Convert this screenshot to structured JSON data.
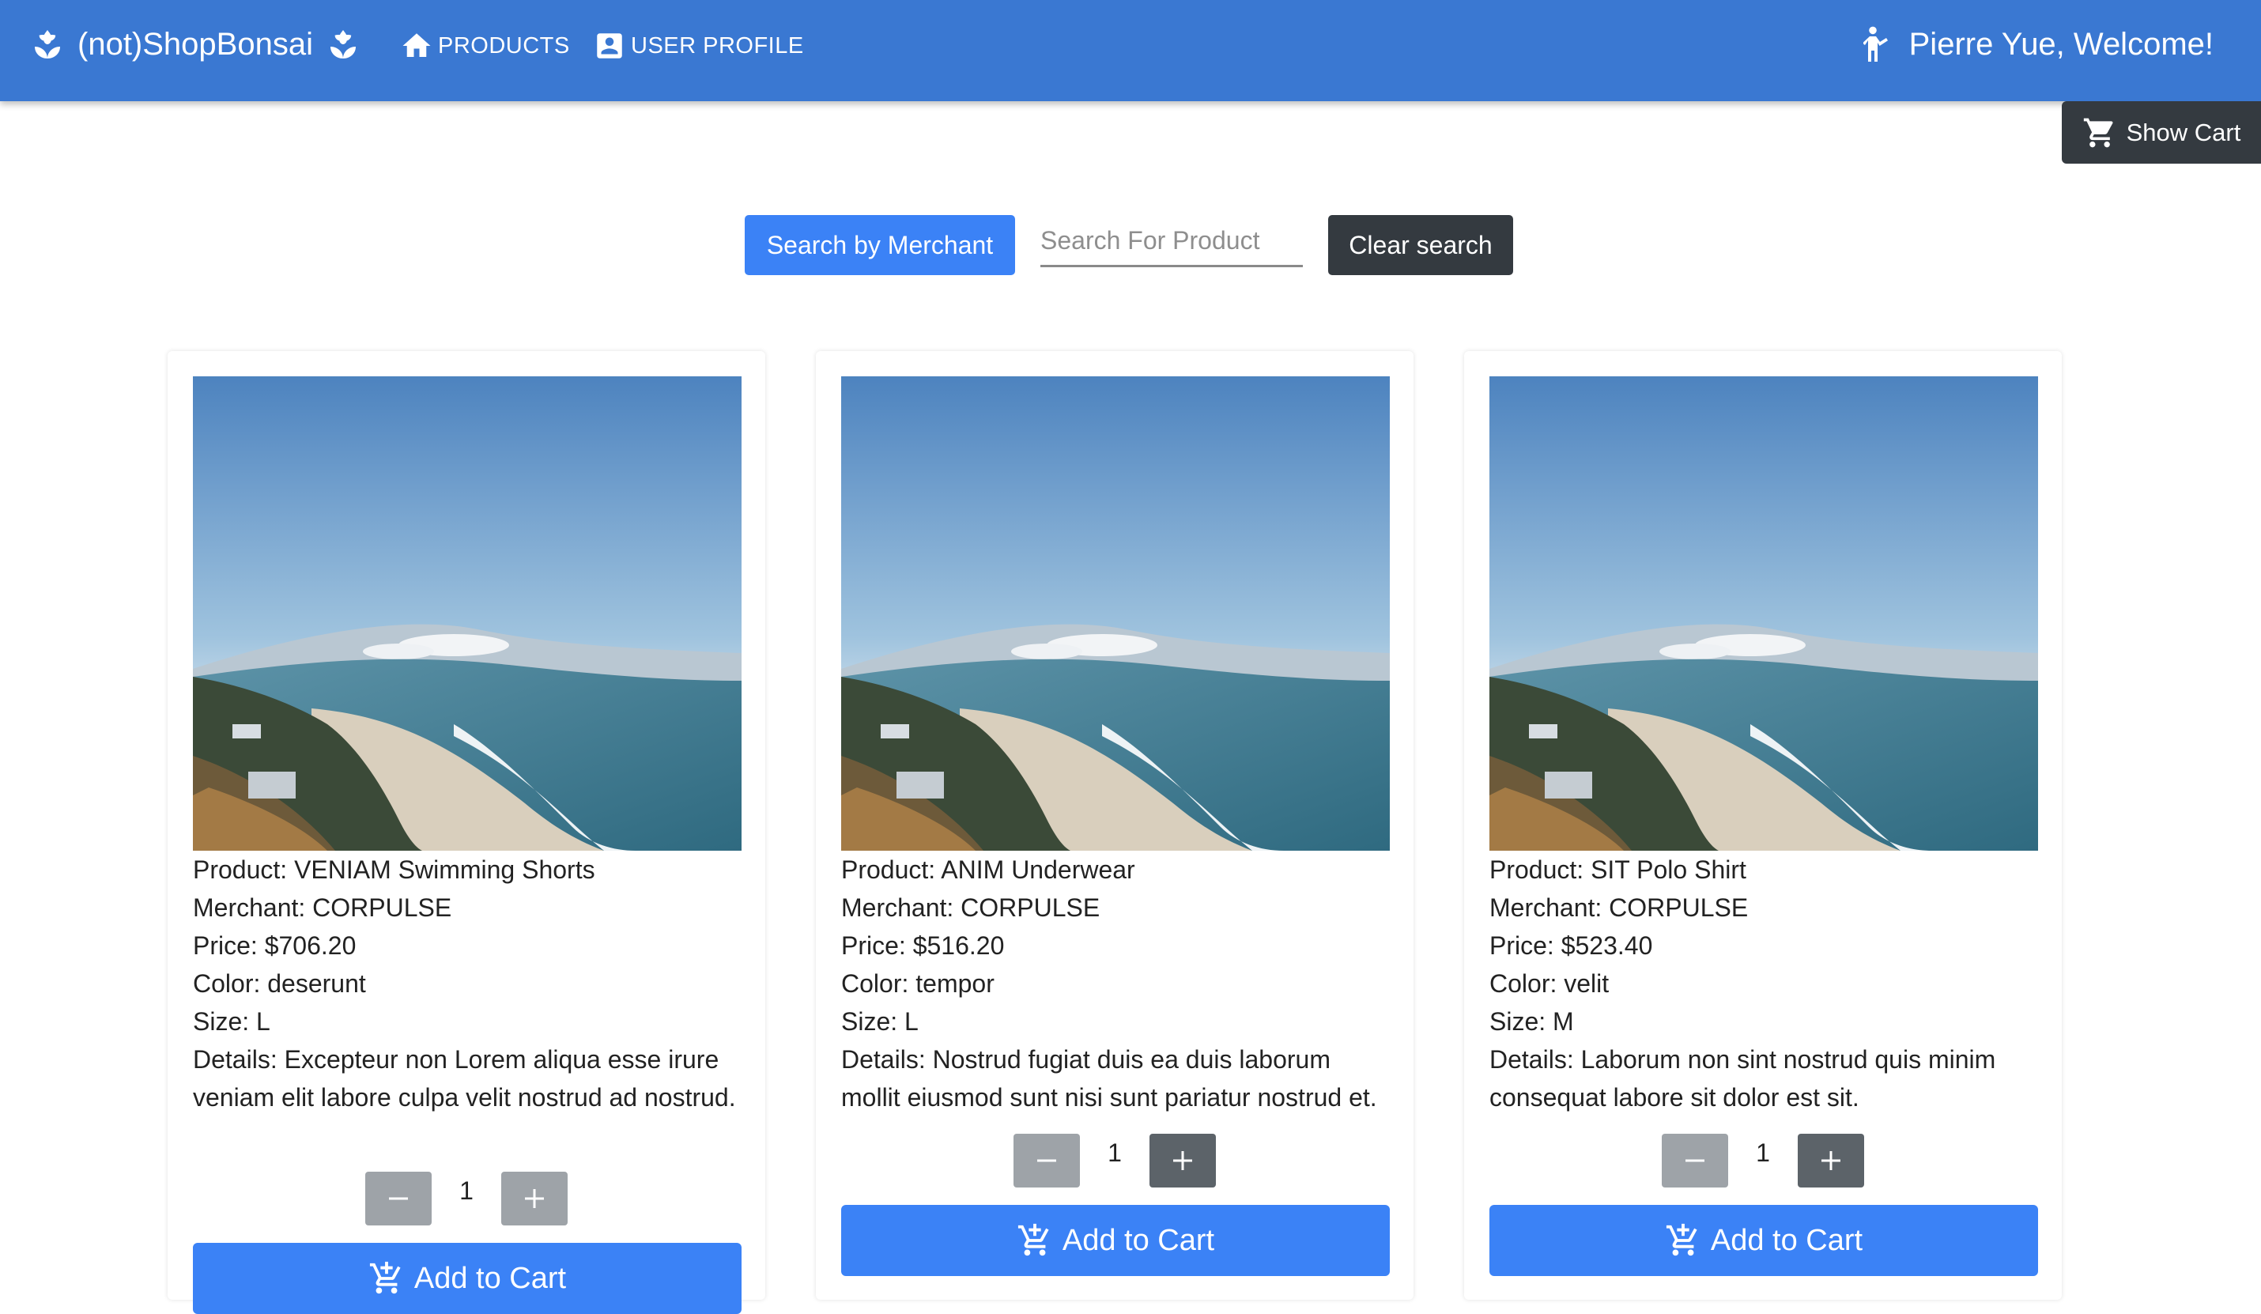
{
  "nav": {
    "brand": "(not)ShopBonsai",
    "products_label": "PRODUCTS",
    "profile_label": "USER PROFILE",
    "welcome": "Pierre Yue, Welcome!"
  },
  "cart": {
    "show_label": "Show Cart"
  },
  "search": {
    "merchant_button": "Search by Merchant",
    "placeholder": "Search For Product",
    "value": "",
    "clear_button": "Clear search"
  },
  "products": [
    {
      "product": "Product: VENIAM Swimming Shorts",
      "merchant": "Merchant: CORPULSE",
      "price": "Price: $706.20",
      "color": "Color: deserunt",
      "size": "Size: L",
      "details": "Details: Excepteur non Lorem aliqua esse irure veniam elit labore culpa velit nostrud ad nostrud.",
      "quantity": "1",
      "add_label": "Add to Cart"
    },
    {
      "product": "Product: ANIM Underwear",
      "merchant": "Merchant: CORPULSE",
      "price": "Price: $516.20",
      "color": "Color: tempor",
      "size": "Size: L",
      "details": "Details: Nostrud fugiat duis ea duis laborum mollit eiusmod sunt nisi sunt pariatur nostrud et.",
      "quantity": "1",
      "add_label": "Add to Cart"
    },
    {
      "product": "Product: SIT Polo Shirt",
      "merchant": "Merchant: CORPULSE",
      "price": "Price: $523.40",
      "color": "Color: velit",
      "size": "Size: M",
      "details": "Details: Laborum non sint nostrud quis minim consequat labore sit dolor est sit.",
      "quantity": "1",
      "add_label": "Add to Cart"
    }
  ],
  "icons": {
    "brand_left": "bonsai-icon",
    "brand_right": "bonsai-icon",
    "products": "home-icon",
    "profile": "account-box-icon",
    "welcome": "person-icon",
    "cart": "shopping-cart-icon",
    "minus": "minus-icon",
    "plus": "plus-icon",
    "add_to_cart": "add-shopping-cart-icon"
  },
  "colors": {
    "nav_background": "#3a78d2",
    "primary": "#3b82f6",
    "dark": "#343a40",
    "qty_button": "#9ea3a8"
  }
}
